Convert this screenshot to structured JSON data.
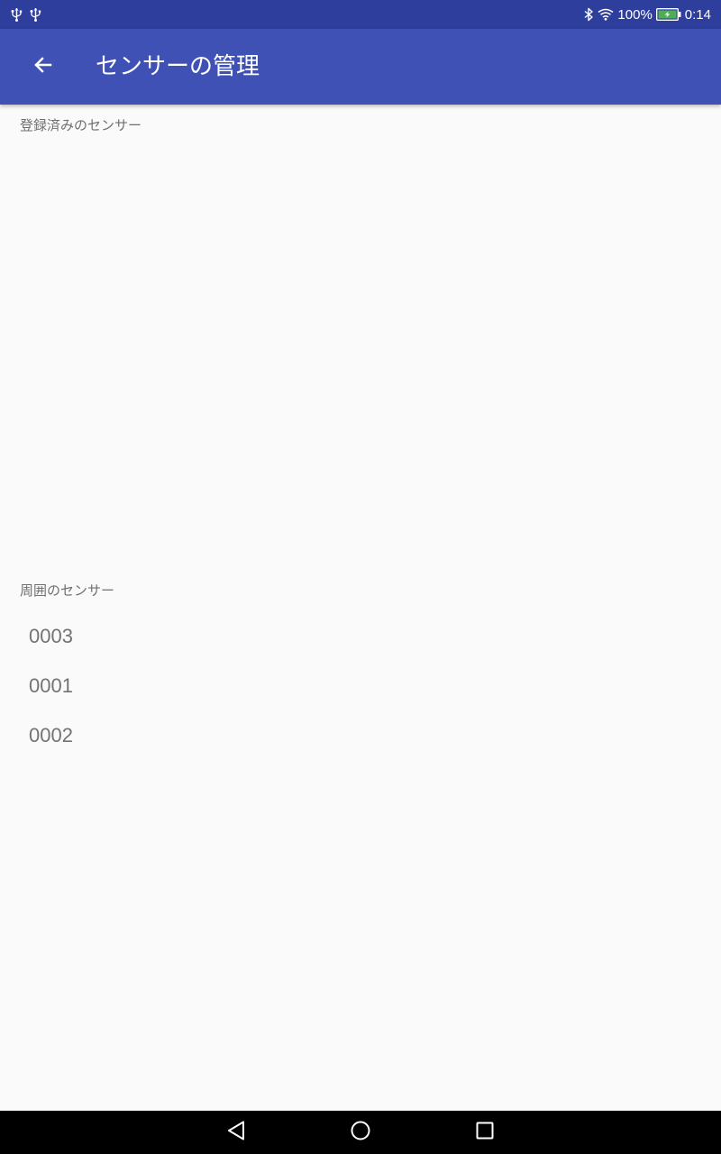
{
  "status_bar": {
    "battery_percent": "100%",
    "time": "0:14",
    "left_icons": [
      "usb-icon",
      "usb-icon"
    ],
    "right_icons": [
      "bluetooth-icon",
      "wifi-icon",
      "battery-charging-icon"
    ]
  },
  "app_bar": {
    "title": "センサーの管理",
    "back_icon": "arrow-back-icon"
  },
  "registered": {
    "header": "登録済みのセンサー",
    "items": []
  },
  "nearby": {
    "header": "周囲のセンサー",
    "items": [
      "0003",
      "0001",
      "0002"
    ]
  },
  "nav_bar": {
    "buttons": [
      "back-triangle-icon",
      "home-circle-icon",
      "recents-square-icon"
    ]
  },
  "colors": {
    "status_bar": "#2e3e9c",
    "app_bar": "#3f51b5",
    "background": "#fafafa",
    "section_text": "#6f6f6f",
    "item_text": "#737373",
    "battery_fill": "#4caf50"
  }
}
